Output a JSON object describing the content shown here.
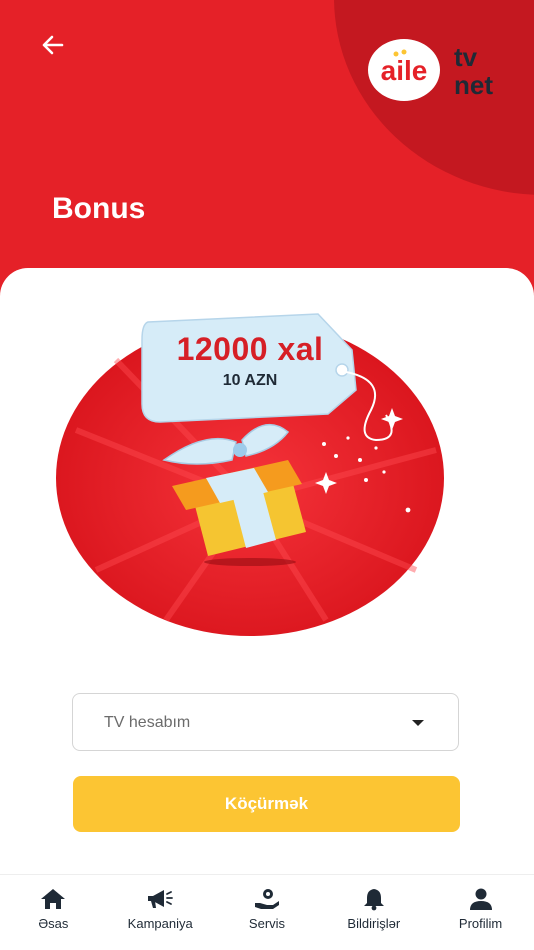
{
  "header": {
    "title": "Bonus",
    "back_icon": "arrow-left-icon",
    "logo_text": [
      "aile",
      "tv",
      "net"
    ]
  },
  "bonus": {
    "points_label": "12000 xal",
    "money_label": "10 AZN"
  },
  "account_select": {
    "value": "TV hesabım",
    "icon": "caret-down-icon"
  },
  "transfer_button": {
    "label": "Köçürmək",
    "color": "#fcc533"
  },
  "nav": {
    "items": [
      {
        "label": "Əsas",
        "icon": "home-icon"
      },
      {
        "label": "Kampaniya",
        "icon": "megaphone-icon"
      },
      {
        "label": "Servis",
        "icon": "service-hand-icon"
      },
      {
        "label": "Bildirişlər",
        "icon": "bell-icon"
      },
      {
        "label": "Profilim",
        "icon": "user-icon"
      }
    ]
  },
  "colors": {
    "brand_red": "#e52128",
    "dark_red": "#c41820",
    "text_dark": "#1f2a36"
  }
}
